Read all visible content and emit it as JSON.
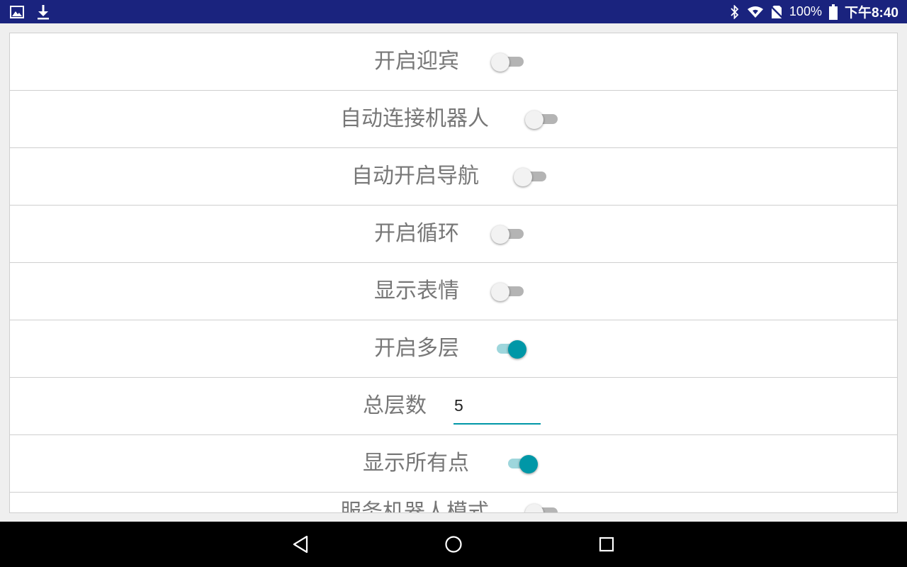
{
  "status_bar": {
    "left_icons": [
      "image-icon",
      "download-icon"
    ],
    "right_icons": [
      "bluetooth-icon",
      "wifi-icon",
      "no-sim-icon",
      "battery-icon"
    ],
    "battery": "100%",
    "time": "下午8:40"
  },
  "settings": [
    {
      "label": "开启迎宾",
      "type": "switch",
      "on": false
    },
    {
      "label": "自动连接机器人",
      "type": "switch",
      "on": false
    },
    {
      "label": "自动开启导航",
      "type": "switch",
      "on": false
    },
    {
      "label": "开启循环",
      "type": "switch",
      "on": false
    },
    {
      "label": "显示表情",
      "type": "switch",
      "on": false
    },
    {
      "label": "开启多层",
      "type": "switch",
      "on": true
    },
    {
      "label": "总层数",
      "type": "input",
      "value": "5"
    },
    {
      "label": "显示所有点",
      "type": "switch",
      "on": true
    },
    {
      "label": "服务机器人模式",
      "type": "switch",
      "on": false
    }
  ],
  "colors": {
    "status_bar_bg": "#1a237e",
    "accent": "#0097a7",
    "switch_off_track": "#b4b4b4"
  },
  "nav_bar": {
    "buttons": [
      "back-icon",
      "home-icon",
      "recents-icon"
    ]
  }
}
